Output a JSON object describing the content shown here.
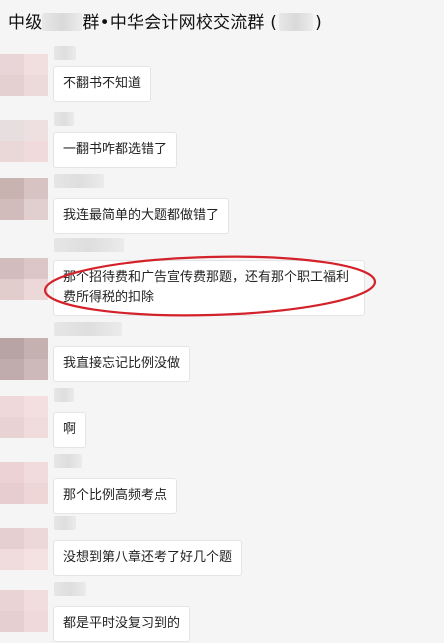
{
  "chat": {
    "title_prefix": "中级",
    "title_suffix": "群•中华会计网校交流群 (",
    "title_end": ")"
  },
  "messages": [
    {
      "text": "不翻书不知道"
    },
    {
      "text": "一翻书咋都选错了"
    },
    {
      "text": "我连最简单的大题都做错了"
    },
    {
      "text": "那个招待费和广告宣传费那题，还有那个职工福利费所得税的扣除"
    },
    {
      "text": "我直接忘记比例没做"
    },
    {
      "text": "啊"
    },
    {
      "text": "那个比例高频考点"
    },
    {
      "text": "没想到第八章还考了好几个题"
    },
    {
      "text": "都是平时没复习到的"
    }
  ],
  "colors": {
    "background": "#f5f5f5",
    "bubble": "#ffffff",
    "annotation": "#d4222a"
  }
}
